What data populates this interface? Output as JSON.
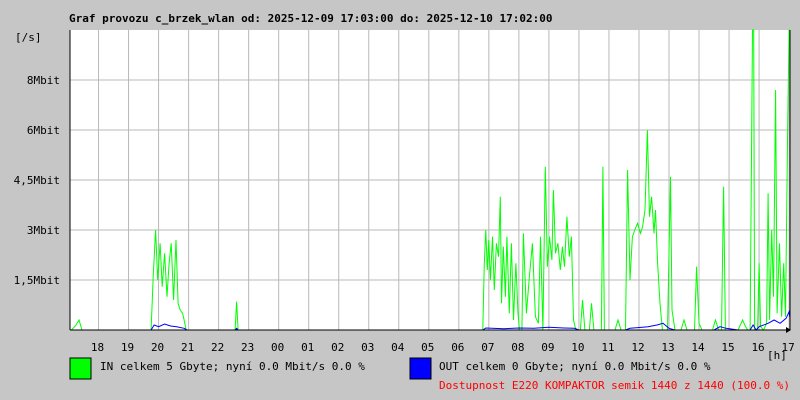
{
  "chart_data": {
    "type": "line",
    "title": "Graf provozu c_brzek_wlan od: 2025-12-09 17:03:00 do: 2025-12-10 17:02:00",
    "ylabel": "[/s]",
    "xlabel": "[h]",
    "y_tick_labels": [
      "1,5Mbit",
      "3Mbit",
      "4,5Mbit",
      "6Mbit",
      "8Mbit"
    ],
    "y_tick_values": [
      1.5,
      3,
      4.5,
      6,
      7.5
    ],
    "ylim": [
      0,
      9
    ],
    "x_tick_labels": [
      "18",
      "19",
      "20",
      "21",
      "22",
      "23",
      "00",
      "01",
      "02",
      "03",
      "04",
      "05",
      "06",
      "07",
      "08",
      "09",
      "10",
      "11",
      "12",
      "13",
      "14",
      "15",
      "16",
      "17"
    ],
    "x_tick_values": [
      18,
      19,
      20,
      21,
      22,
      23,
      24,
      25,
      26,
      27,
      28,
      29,
      30,
      31,
      32,
      33,
      34,
      35,
      36,
      37,
      38,
      39,
      40,
      41
    ],
    "xlim": [
      17.05,
      41.03
    ],
    "grid": true,
    "colors": {
      "background": "#c6c6c6",
      "plot_background": "#ffffff",
      "grid": "#b8b8b8",
      "axis": "#000000",
      "in": "#00ff00",
      "out": "#0000ff",
      "availability": "#ff0000"
    },
    "series": [
      {
        "key": "in",
        "values": [
          [
            17.1,
            0
          ],
          [
            17.25,
            0.15
          ],
          [
            17.35,
            0.3
          ],
          [
            17.45,
            0
          ],
          [
            17.7,
            0
          ],
          [
            18.2,
            0
          ],
          [
            18.8,
            0
          ],
          [
            19.4,
            0
          ],
          [
            19.75,
            0
          ],
          [
            19.82,
            1.6
          ],
          [
            19.9,
            3.0
          ],
          [
            19.97,
            1.5
          ],
          [
            20.05,
            2.6
          ],
          [
            20.12,
            1.3
          ],
          [
            20.2,
            2.3
          ],
          [
            20.28,
            1.0
          ],
          [
            20.35,
            2.0
          ],
          [
            20.42,
            2.6
          ],
          [
            20.5,
            0.9
          ],
          [
            20.58,
            2.7
          ],
          [
            20.65,
            0.8
          ],
          [
            20.72,
            0.6
          ],
          [
            20.8,
            0.5
          ],
          [
            20.85,
            0.3
          ],
          [
            20.92,
            0
          ],
          [
            21.6,
            0
          ],
          [
            22.55,
            0
          ],
          [
            22.6,
            0.85
          ],
          [
            22.65,
            0
          ],
          [
            23.5,
            0
          ],
          [
            24.6,
            0
          ],
          [
            25.5,
            0
          ],
          [
            26.5,
            0
          ],
          [
            27.5,
            0
          ],
          [
            28.5,
            0
          ],
          [
            29.5,
            0
          ],
          [
            30.3,
            0
          ],
          [
            30.8,
            0
          ],
          [
            30.85,
            2.0
          ],
          [
            30.9,
            3.0
          ],
          [
            30.95,
            1.8
          ],
          [
            31.0,
            2.7
          ],
          [
            31.05,
            1.5
          ],
          [
            31.12,
            2.8
          ],
          [
            31.18,
            1.2
          ],
          [
            31.25,
            2.6
          ],
          [
            31.32,
            2.2
          ],
          [
            31.38,
            4.0
          ],
          [
            31.42,
            0.8
          ],
          [
            31.48,
            2.5
          ],
          [
            31.55,
            1.0
          ],
          [
            31.6,
            2.8
          ],
          [
            31.68,
            0.5
          ],
          [
            31.75,
            2.6
          ],
          [
            31.82,
            0.3
          ],
          [
            31.9,
            2.0
          ],
          [
            31.97,
            0.5
          ],
          [
            32.02,
            0
          ],
          [
            32.1,
            0
          ],
          [
            32.15,
            2.9
          ],
          [
            32.25,
            0.5
          ],
          [
            32.35,
            1.6
          ],
          [
            32.45,
            2.6
          ],
          [
            32.55,
            0.4
          ],
          [
            32.65,
            0.2
          ],
          [
            32.72,
            2.8
          ],
          [
            32.8,
            0
          ],
          [
            32.88,
            4.9
          ],
          [
            32.95,
            1.9
          ],
          [
            33.02,
            2.8
          ],
          [
            33.1,
            2.1
          ],
          [
            33.15,
            4.2
          ],
          [
            33.22,
            2.3
          ],
          [
            33.3,
            2.6
          ],
          [
            33.38,
            1.8
          ],
          [
            33.45,
            2.5
          ],
          [
            33.52,
            1.9
          ],
          [
            33.6,
            3.4
          ],
          [
            33.68,
            2.2
          ],
          [
            33.75,
            2.8
          ],
          [
            33.82,
            0.3
          ],
          [
            33.9,
            0
          ],
          [
            34.05,
            0
          ],
          [
            34.12,
            0.9
          ],
          [
            34.2,
            0
          ],
          [
            34.35,
            0
          ],
          [
            34.42,
            0.8
          ],
          [
            34.5,
            0
          ],
          [
            34.75,
            0
          ],
          [
            34.8,
            4.9
          ],
          [
            34.85,
            0
          ],
          [
            35.2,
            0
          ],
          [
            35.3,
            0.3
          ],
          [
            35.4,
            0
          ],
          [
            35.55,
            0
          ],
          [
            35.62,
            4.8
          ],
          [
            35.7,
            1.5
          ],
          [
            35.78,
            2.8
          ],
          [
            35.86,
            3.0
          ],
          [
            35.95,
            3.2
          ],
          [
            36.05,
            2.9
          ],
          [
            36.12,
            3.1
          ],
          [
            36.2,
            3.6
          ],
          [
            36.28,
            6.0
          ],
          [
            36.35,
            3.4
          ],
          [
            36.42,
            4.0
          ],
          [
            36.5,
            2.9
          ],
          [
            36.55,
            3.6
          ],
          [
            36.62,
            2.0
          ],
          [
            36.7,
            0.8
          ],
          [
            36.78,
            0
          ],
          [
            36.95,
            0
          ],
          [
            37.05,
            4.6
          ],
          [
            37.1,
            0.6
          ],
          [
            37.2,
            0
          ],
          [
            37.4,
            0
          ],
          [
            37.5,
            0.3
          ],
          [
            37.6,
            0
          ],
          [
            37.85,
            0
          ],
          [
            37.92,
            1.9
          ],
          [
            38.0,
            0.2
          ],
          [
            38.1,
            0
          ],
          [
            38.45,
            0
          ],
          [
            38.55,
            0.3
          ],
          [
            38.65,
            0
          ],
          [
            38.75,
            0
          ],
          [
            38.82,
            4.3
          ],
          [
            38.88,
            0
          ],
          [
            39.3,
            0
          ],
          [
            39.45,
            0.3
          ],
          [
            39.55,
            0.1
          ],
          [
            39.62,
            0
          ],
          [
            39.7,
            0
          ],
          [
            39.78,
            9.0
          ],
          [
            39.82,
            9.0
          ],
          [
            39.85,
            0
          ],
          [
            39.95,
            0
          ],
          [
            40.0,
            2.0
          ],
          [
            40.05,
            0.1
          ],
          [
            40.15,
            0
          ],
          [
            40.25,
            0.2
          ],
          [
            40.3,
            4.1
          ],
          [
            40.35,
            0.3
          ],
          [
            40.42,
            3.0
          ],
          [
            40.48,
            1.0
          ],
          [
            40.55,
            7.2
          ],
          [
            40.6,
            0.5
          ],
          [
            40.68,
            2.6
          ],
          [
            40.75,
            0.4
          ],
          [
            40.82,
            2.0
          ],
          [
            40.88,
            0.4
          ],
          [
            40.95,
            5.9
          ],
          [
            41.0,
            9.0
          ],
          [
            41.02,
            9.0
          ]
        ]
      },
      {
        "key": "out",
        "values": [
          [
            17.1,
            0
          ],
          [
            19.75,
            0
          ],
          [
            19.85,
            0.15
          ],
          [
            20.0,
            0.1
          ],
          [
            20.2,
            0.18
          ],
          [
            20.4,
            0.12
          ],
          [
            20.6,
            0.1
          ],
          [
            20.85,
            0.05
          ],
          [
            20.95,
            0
          ],
          [
            22.55,
            0
          ],
          [
            22.6,
            0.05
          ],
          [
            22.65,
            0
          ],
          [
            30.8,
            0
          ],
          [
            30.9,
            0.06
          ],
          [
            31.5,
            0.04
          ],
          [
            32.0,
            0.06
          ],
          [
            32.5,
            0.05
          ],
          [
            33.0,
            0.08
          ],
          [
            33.5,
            0.06
          ],
          [
            33.85,
            0.05
          ],
          [
            34.0,
            0
          ],
          [
            35.55,
            0
          ],
          [
            35.7,
            0.05
          ],
          [
            36.3,
            0.1
          ],
          [
            36.6,
            0.15
          ],
          [
            36.8,
            0.2
          ],
          [
            37.0,
            0.05
          ],
          [
            37.2,
            0
          ],
          [
            38.5,
            0
          ],
          [
            38.7,
            0.1
          ],
          [
            38.9,
            0.05
          ],
          [
            39.3,
            0
          ],
          [
            39.7,
            0
          ],
          [
            39.8,
            0.15
          ],
          [
            39.9,
            0
          ],
          [
            40.0,
            0.1
          ],
          [
            40.3,
            0.2
          ],
          [
            40.5,
            0.3
          ],
          [
            40.7,
            0.2
          ],
          [
            40.9,
            0.35
          ],
          [
            41.0,
            0.55
          ],
          [
            41.02,
            0.4
          ]
        ]
      }
    ],
    "legend": [
      {
        "key": "in",
        "text": "IN celkem 5 Gbyte; nyní   0.0 Mbit/s 0.0 %",
        "color": "#00ff00"
      },
      {
        "key": "out",
        "text": "OUT celkem 0 Gbyte; nyní   0.0 Mbit/s 0.0 %",
        "color": "#0000ff"
      }
    ],
    "availability": "Dostupnost E220 KOMPAKTOR semik 1440 z 1440 (100.0 %)"
  }
}
